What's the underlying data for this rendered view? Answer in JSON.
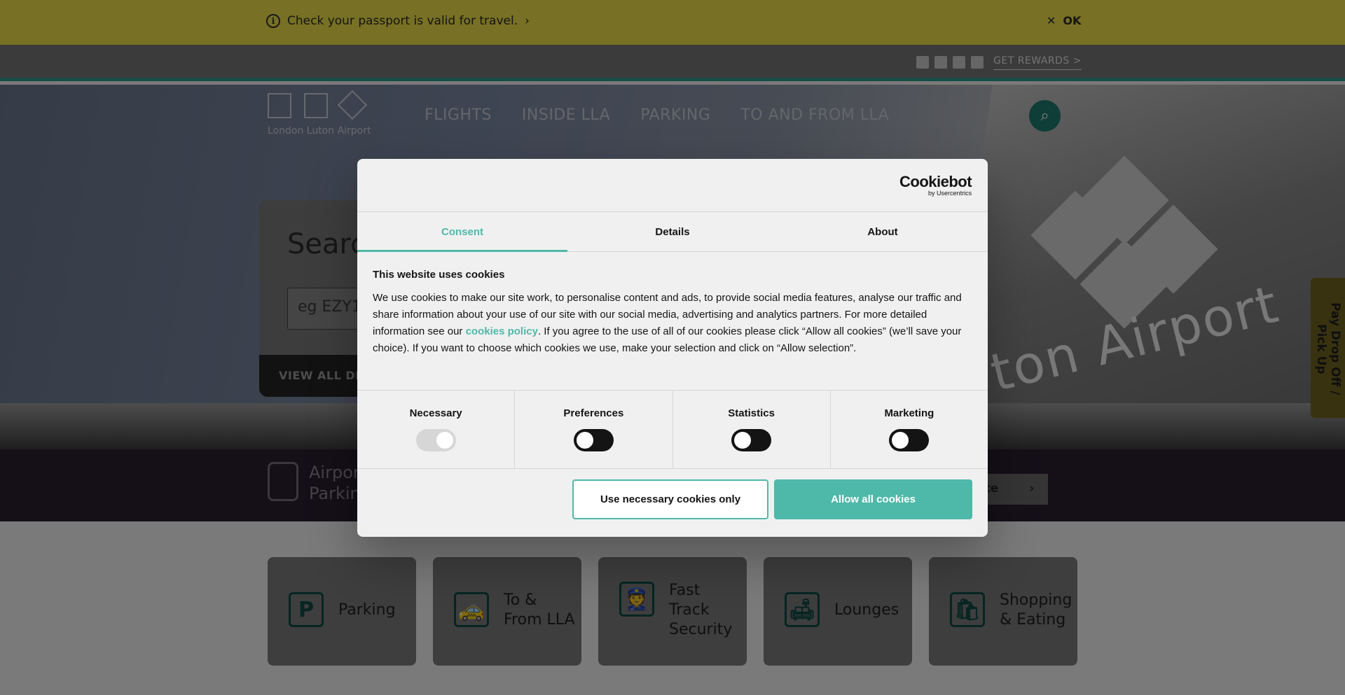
{
  "alert": {
    "message": "Check your passport is valid for travel.",
    "chevron": "›",
    "ok_label": "OK",
    "close_glyph": "✕"
  },
  "utility": {
    "rewards_label": "GET REWARDS >"
  },
  "header": {
    "logo_text": "London Luton Airport",
    "nav": [
      "FLIGHTS",
      "INSIDE LLA",
      "PARKING",
      "TO AND FROM LLA"
    ],
    "search_glyph": "⌕"
  },
  "hero": {
    "sign_text": "ton Airport"
  },
  "flight_search": {
    "title": "Search",
    "placeholder": "eg EZY1",
    "footer_label": "VIEW ALL DEP"
  },
  "parking_band": {
    "line1": "Airpor",
    "line2": "Parkin",
    "quote_label": "ote",
    "quote_chevron": "›"
  },
  "side_tab": {
    "label": "Pay Drop Off / Pick Up"
  },
  "quick_links": [
    {
      "label_line1": "Parking",
      "label_line2": "",
      "label_line3": "",
      "icon": "P"
    },
    {
      "label_line1": "To &",
      "label_line2": "From LLA",
      "label_line3": "",
      "icon": "🚕"
    },
    {
      "label_line1": "Fast",
      "label_line2": "Track",
      "label_line3": "Security",
      "icon": "👮"
    },
    {
      "label_line1": "Lounges",
      "label_line2": "",
      "label_line3": "",
      "icon": "🛋"
    },
    {
      "label_line1": "Shopping",
      "label_line2": "& Eating",
      "label_line3": "",
      "icon": "🛍"
    }
  ],
  "cookie_dialog": {
    "brand": "Cookiebot",
    "brand_sub": "by Usercentrics",
    "tabs": [
      "Consent",
      "Details",
      "About"
    ],
    "active_tab": "Consent",
    "heading": "This website uses cookies",
    "body_part1": "We use cookies to make our site work, to personalise content and ads, to provide social media features, analyse our traffic and share information about your use of our site with our social media, advertising and analytics partners. For more detailed information see our ",
    "body_link": "cookies policy",
    "body_part2": ". If you agree to the use of all of our cookies please click “Allow all cookies” (we’ll save your choice). If you want to choose which cookies we use, make your selection and click on “Allow selection”.",
    "toggles": [
      {
        "label": "Necessary",
        "on": true,
        "disabled": true
      },
      {
        "label": "Preferences",
        "on": false,
        "disabled": false
      },
      {
        "label": "Statistics",
        "on": false,
        "disabled": false
      },
      {
        "label": "Marketing",
        "on": false,
        "disabled": false
      }
    ],
    "btn_necessary": "Use necessary cookies only",
    "btn_allow_all": "Allow all cookies",
    "accent_color": "#4fb9a9"
  }
}
